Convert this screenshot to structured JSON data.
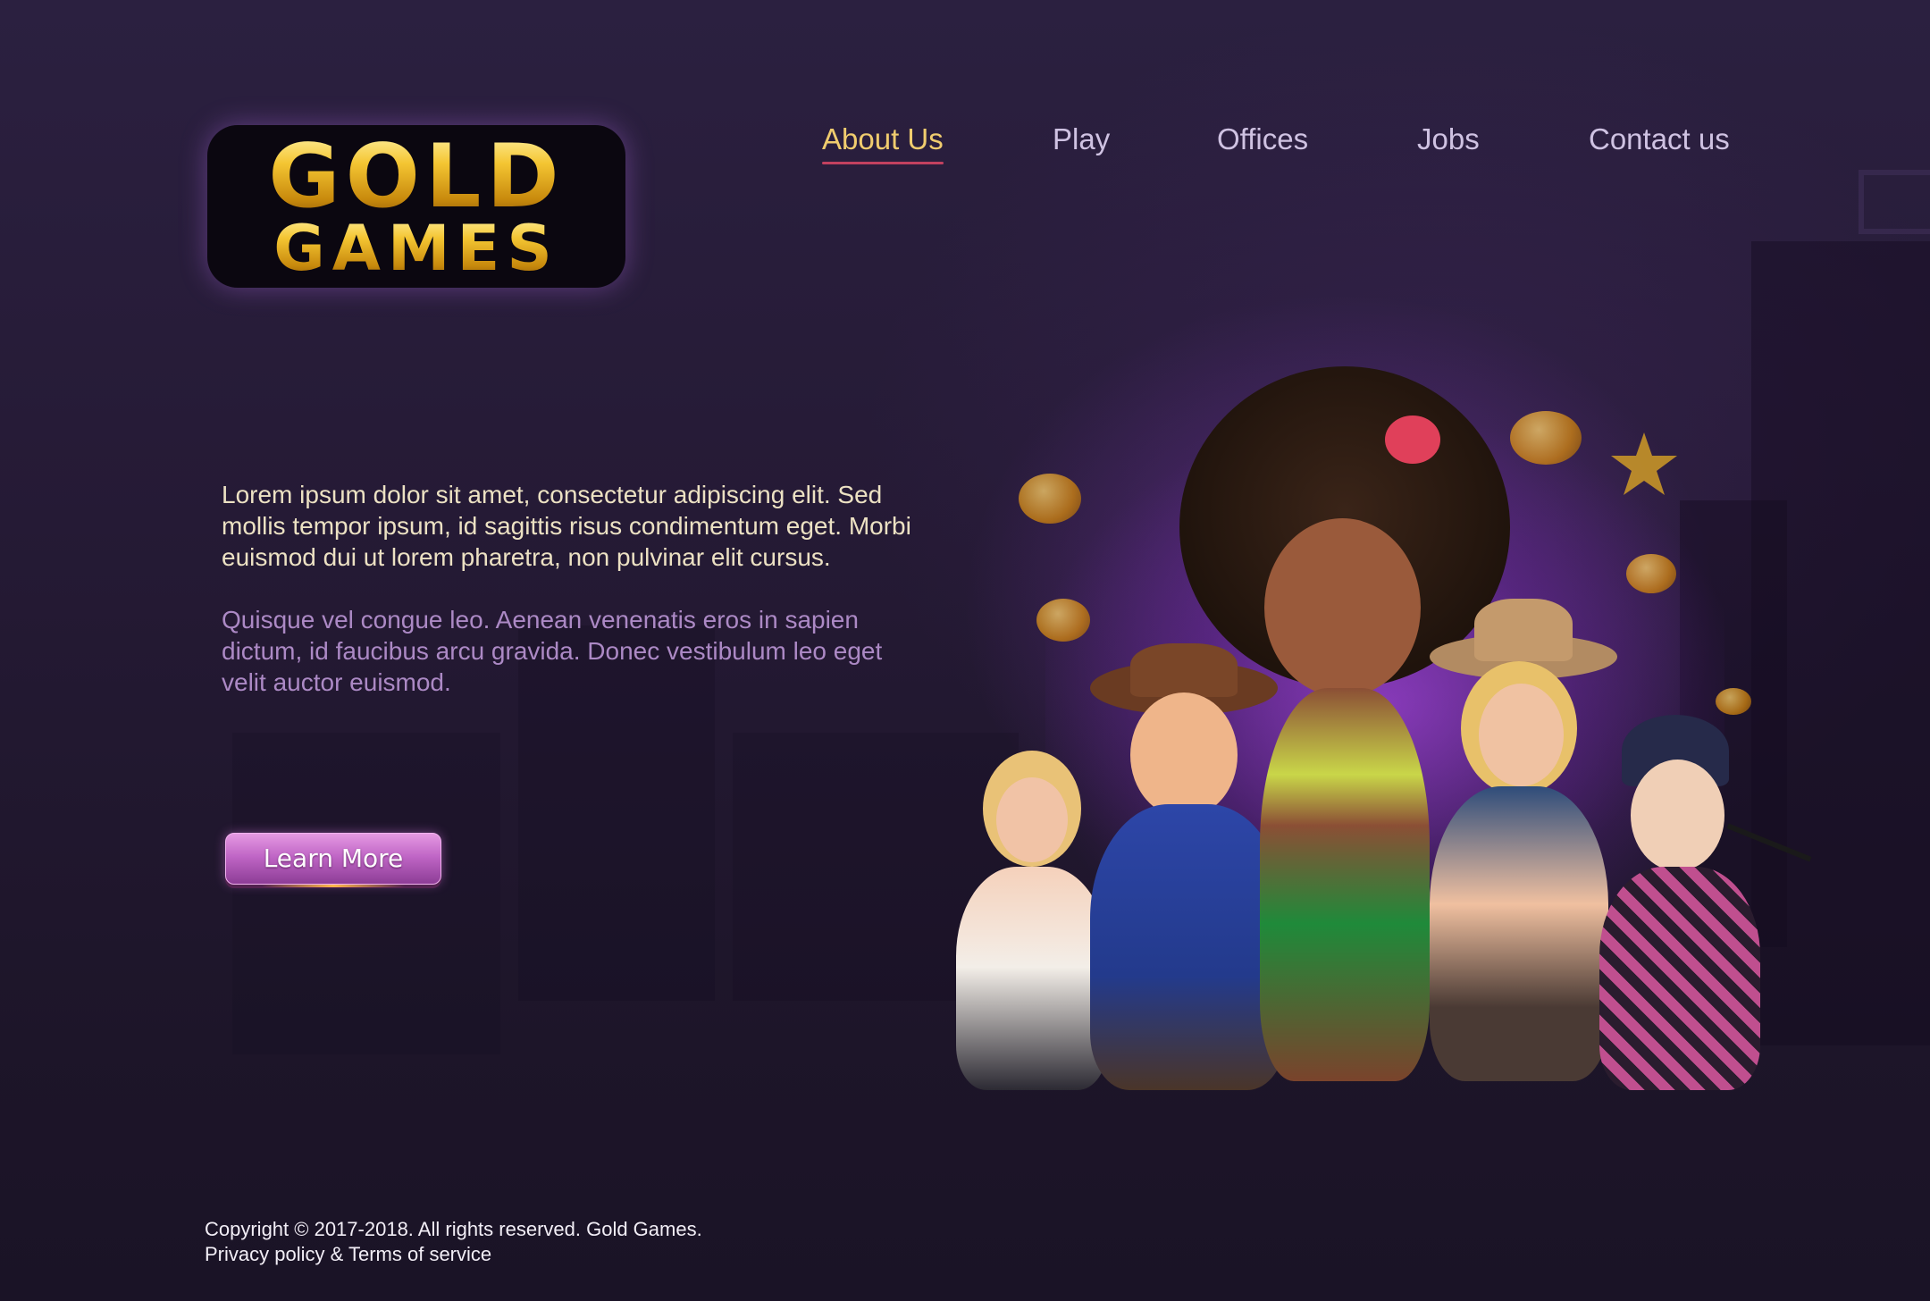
{
  "brand": {
    "logo_line1": "GOLD",
    "logo_line2": "GAMES",
    "colors": {
      "gold": "#f4c532",
      "background": "#241a34",
      "accent_purple": "#c066c6",
      "nav_active": "#f0cc6e",
      "nav_underline": "#c2415f"
    }
  },
  "nav": {
    "items": [
      {
        "label": "About Us",
        "active": true
      },
      {
        "label": "Play",
        "active": false
      },
      {
        "label": "Offices",
        "active": false
      },
      {
        "label": "Jobs",
        "active": false
      },
      {
        "label": "Contact us",
        "active": false
      }
    ]
  },
  "main": {
    "paragraph1": "Lorem ipsum dolor sit amet, consectetur adipiscing elit. Sed mollis tempor ipsum, id sagittis risus condimentum eget. Morbi euismod dui ut lorem pharetra, non pulvinar elit cursus.",
    "paragraph2": "Quisque vel congue leo. Aenean venenatis eros in sapien dictum, id faucibus arcu gravida. Donec vestibulum leo eget velit auctor euismod.",
    "cta_label": "Learn More"
  },
  "footer": {
    "copyright": "Copyright © 2017-2018. All rights reserved. Gold Games.",
    "links": "Privacy policy & Terms of service"
  }
}
